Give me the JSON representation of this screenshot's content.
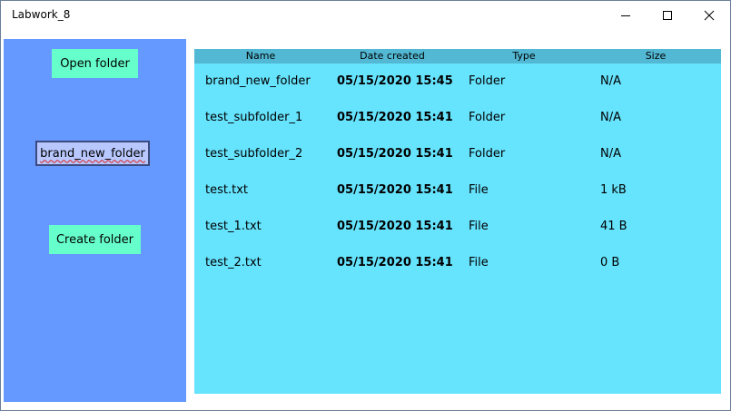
{
  "window": {
    "title": "Labwork_8",
    "controls": [
      "minimize-icon",
      "maximize-icon",
      "close-icon"
    ]
  },
  "sidebar": {
    "open_folder_label": "Open folder",
    "folder_name_value": "brand_new_folder",
    "create_folder_label": "Create folder"
  },
  "list": {
    "columns": [
      "Name",
      "Date created",
      "Type",
      "Size"
    ],
    "rows": [
      {
        "name": "brand_new_folder",
        "date": "05/15/2020 15:45",
        "type": "Folder",
        "size": "N/A"
      },
      {
        "name": "test_subfolder_1",
        "date": "05/15/2020 15:41",
        "type": "Folder",
        "size": "N/A"
      },
      {
        "name": "test_subfolder_2",
        "date": "05/15/2020 15:41",
        "type": "Folder",
        "size": "N/A"
      },
      {
        "name": "test.txt",
        "date": "05/15/2020 15:41",
        "type": "File",
        "size": "1 kB"
      },
      {
        "name": "test_1.txt",
        "date": "05/15/2020 15:41",
        "type": "File",
        "size": "41 B"
      },
      {
        "name": "test_2.txt",
        "date": "05/15/2020 15:41",
        "type": "File",
        "size": "0 B"
      }
    ]
  },
  "colors": {
    "sidebar": "#6699ff",
    "button": "#66ffcc",
    "list_background": "#66e3fd",
    "list_header": "#53b8d3",
    "input_background": "#b8c8ff",
    "spellcheck": "#e02020"
  }
}
